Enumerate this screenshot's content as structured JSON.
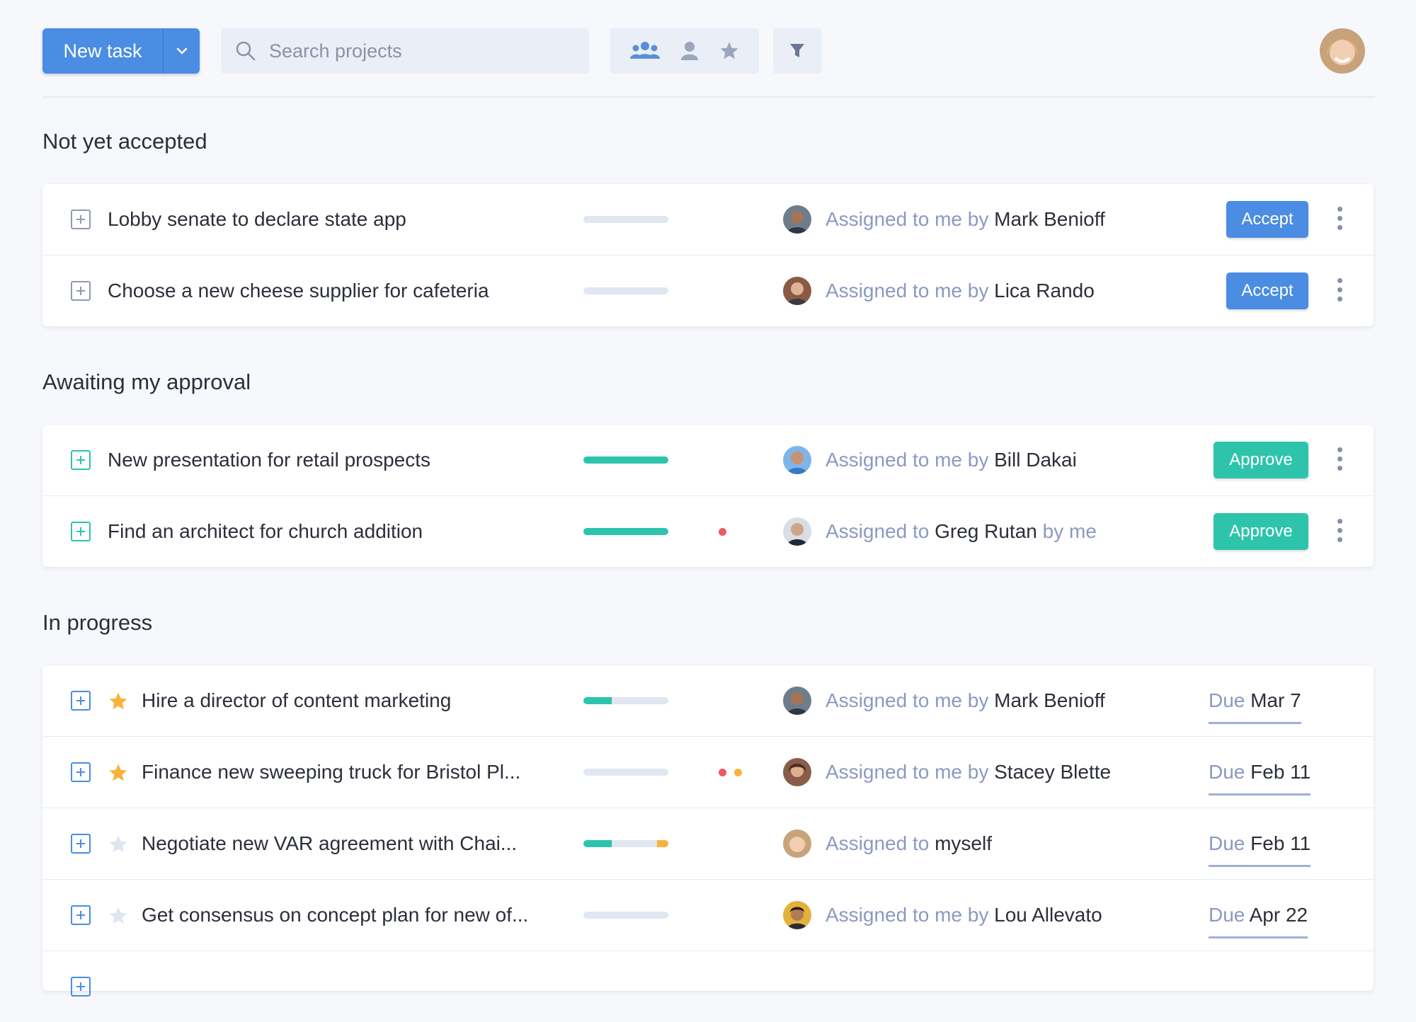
{
  "header": {
    "new_task_label": "New task",
    "search_placeholder": "Search projects",
    "filter_icons": [
      "team-icon",
      "person-icon",
      "star-icon"
    ],
    "funnel_icon": "filter-funnel-icon",
    "user_avatar": "user-avatar"
  },
  "colors": {
    "primary": "#4a8de3",
    "teal": "#2ec4ac",
    "red": "#ef5968",
    "amber": "#f6b33c",
    "muted_text": "#8b99c2"
  },
  "sections": [
    {
      "title": "Not yet accepted",
      "rows": [
        {
          "name": "Lobby senate to declare state app",
          "assign_pre": "Assigned to me by",
          "assign_name": "Mark Benioff",
          "assign_post": "",
          "action": "Accept",
          "progress": {
            "done": 0,
            "extra": 0
          }
        },
        {
          "name": "Choose a new cheese supplier for cafeteria",
          "assign_pre": "Assigned to me by",
          "assign_name": "Lica Rando",
          "assign_post": "",
          "action": "Accept",
          "progress": {
            "done": 0,
            "extra": 0
          }
        }
      ]
    },
    {
      "title": "Awaiting my approval",
      "rows": [
        {
          "name": "New presentation for retail prospects",
          "assign_pre": "Assigned to me by",
          "assign_name": "Bill Dakai",
          "assign_post": "",
          "action": "Approve",
          "progress": {
            "done": 1.0,
            "extra": 0
          }
        },
        {
          "name": "Find an architect for church addition",
          "assign_pre": "Assigned to",
          "assign_name": "Greg Rutan",
          "assign_post": "by me",
          "action": "Approve",
          "progress": {
            "done": 1.0,
            "extra": 0
          },
          "dots": [
            "#ef5968"
          ]
        }
      ]
    },
    {
      "title": "In progress",
      "rows": [
        {
          "name": "Hire a director of content marketing",
          "starred": true,
          "assign_pre": "Assigned to me by",
          "assign_name": "Mark Benioff",
          "assign_post": "",
          "due_label": "Due",
          "due_date": "Mar 7",
          "progress": {
            "done": 0.33,
            "extra": 0
          }
        },
        {
          "name": "Finance new sweeping truck for Bristol Pl...",
          "starred": true,
          "assign_pre": "Assigned to me by",
          "assign_name": "Stacey Blette",
          "assign_post": "",
          "due_label": "Due",
          "due_date": "Feb 11",
          "progress": {
            "done": 0,
            "extra": 0
          },
          "dots": [
            "#ef5968",
            "#f6b33c"
          ]
        },
        {
          "name": "Negotiate new VAR agreement with Chai...",
          "starred": false,
          "assign_pre": "Assigned to",
          "assign_name": "myself",
          "assign_post": "",
          "due_label": "Due",
          "due_date": "Feb 11",
          "progress": {
            "done": 0.33,
            "extra": 0.13
          }
        },
        {
          "name": "Get consensus on concept plan for new of...",
          "starred": false,
          "assign_pre": "Assigned to me by",
          "assign_name": "Lou Allevato",
          "assign_post": "",
          "due_label": "Due",
          "due_date": "Apr 22",
          "progress": {
            "done": 0,
            "extra": 0
          }
        }
      ]
    }
  ]
}
